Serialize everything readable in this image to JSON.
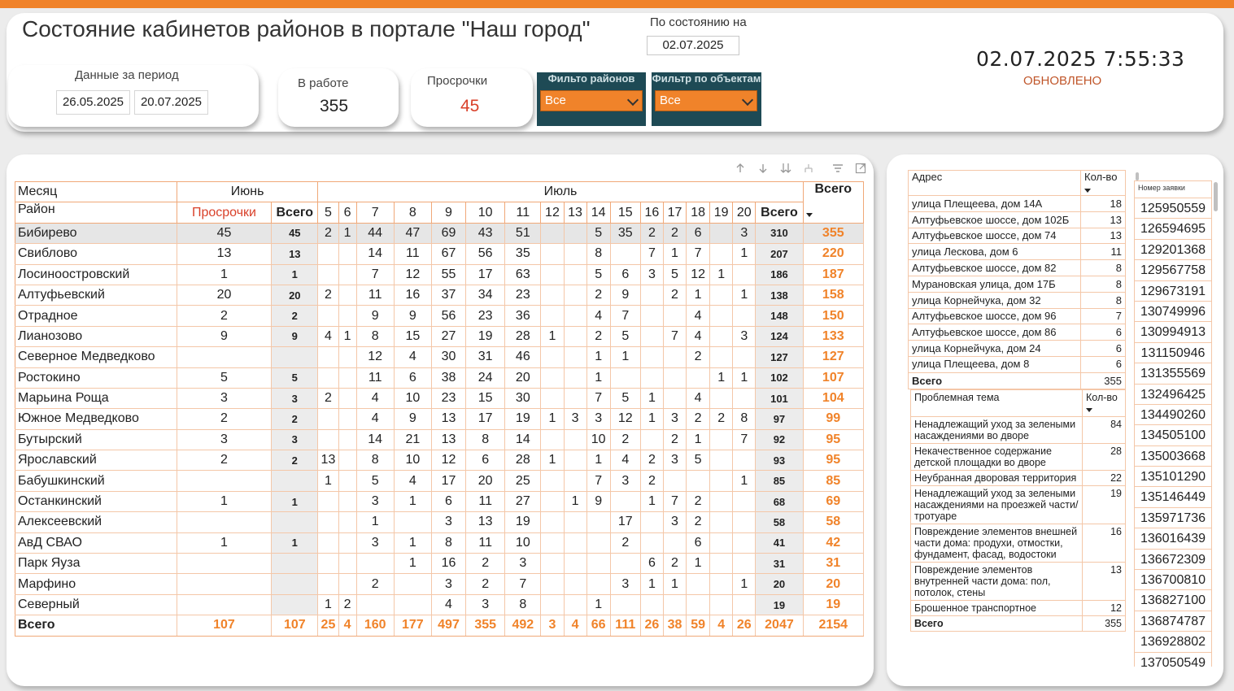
{
  "header": {
    "title": "Состояние кабинетов районов  в  портале \"Наш город\"",
    "asof_label": "По состоянию на",
    "asof_value": "02.07.2025",
    "clock": "02.07.2025 7:55:33",
    "updated": "ОБНОВЛЕНО"
  },
  "kpi": {
    "period_label": "Данные за период",
    "period_from": "26.05.2025",
    "period_to": "20.07.2025",
    "work_label": "В работе",
    "work_value": "355",
    "overdue_label": "Просрочки",
    "overdue_value": "45"
  },
  "filters": {
    "district_title": "Фильто районов",
    "district_value": "Все",
    "object_title": "Фильтр по объектам",
    "object_value": "Все"
  },
  "colors": {
    "accent": "#f0832a",
    "overdue": "#d9412a",
    "filter_bg": "#1e4a55"
  },
  "matrix": {
    "month_header": "Месяц",
    "district_header": "Район",
    "june": "Июнь",
    "july": "Июль",
    "total_header": "Всего",
    "overdue_header": "Просрочки",
    "vsego_header": "Всего",
    "days": [
      "5",
      "6",
      "7",
      "8",
      "9",
      "10",
      "11",
      "12",
      "13",
      "14",
      "15",
      "16",
      "17",
      "18",
      "19",
      "20"
    ],
    "rows": [
      {
        "name": "Бибирево",
        "overdue": "45",
        "june_total": "45",
        "days": [
          "2",
          "1",
          "44",
          "47",
          "69",
          "43",
          "51",
          "",
          "",
          "5",
          "35",
          "2",
          "2",
          "6",
          "",
          "3"
        ],
        "july_total": "310",
        "total": "355"
      },
      {
        "name": "Свиблово",
        "overdue": "13",
        "june_total": "13",
        "days": [
          "",
          "",
          "14",
          "11",
          "67",
          "56",
          "35",
          "",
          "",
          "8",
          "",
          "7",
          "1",
          "7",
          "",
          "1"
        ],
        "july_total": "207",
        "total": "220"
      },
      {
        "name": "Лосиноостровский",
        "overdue": "1",
        "june_total": "1",
        "days": [
          "",
          "",
          "7",
          "12",
          "55",
          "17",
          "63",
          "",
          "",
          "5",
          "6",
          "3",
          "5",
          "12",
          "1",
          ""
        ],
        "july_total": "186",
        "total": "187"
      },
      {
        "name": "Алтуфьевский",
        "overdue": "20",
        "june_total": "20",
        "days": [
          "2",
          "",
          "11",
          "16",
          "37",
          "34",
          "23",
          "",
          "",
          "2",
          "9",
          "",
          "2",
          "1",
          "",
          "1"
        ],
        "july_total": "138",
        "total": "158"
      },
      {
        "name": "Отрадное",
        "overdue": "2",
        "june_total": "2",
        "days": [
          "",
          "",
          "9",
          "9",
          "56",
          "23",
          "36",
          "",
          "",
          "4",
          "7",
          "",
          "",
          "4",
          "",
          ""
        ],
        "july_total": "148",
        "total": "150"
      },
      {
        "name": "Лианозово",
        "overdue": "9",
        "june_total": "9",
        "days": [
          "4",
          "1",
          "8",
          "15",
          "27",
          "19",
          "28",
          "1",
          "",
          "2",
          "5",
          "",
          "7",
          "4",
          "",
          "3"
        ],
        "july_total": "124",
        "total": "133"
      },
      {
        "name": "Северное Медведково",
        "overdue": "",
        "june_total": "",
        "days": [
          "",
          "",
          "12",
          "4",
          "30",
          "31",
          "46",
          "",
          "",
          "1",
          "1",
          "",
          "",
          "2",
          "",
          ""
        ],
        "july_total": "127",
        "total": "127"
      },
      {
        "name": "Ростокино",
        "overdue": "5",
        "june_total": "5",
        "days": [
          "",
          "",
          "11",
          "6",
          "38",
          "24",
          "20",
          "",
          "",
          "1",
          "",
          "",
          "",
          "",
          "1",
          "1"
        ],
        "july_total": "102",
        "total": "107"
      },
      {
        "name": "Марьина Роща",
        "overdue": "3",
        "june_total": "3",
        "days": [
          "2",
          "",
          "4",
          "10",
          "23",
          "15",
          "30",
          "",
          "",
          "7",
          "5",
          "1",
          "",
          "4",
          "",
          ""
        ],
        "july_total": "101",
        "total": "104"
      },
      {
        "name": "Южное Медведково",
        "overdue": "2",
        "june_total": "2",
        "days": [
          "",
          "",
          "4",
          "9",
          "13",
          "17",
          "19",
          "1",
          "3",
          "3",
          "12",
          "1",
          "3",
          "2",
          "2",
          "8"
        ],
        "july_total": "97",
        "total": "99"
      },
      {
        "name": "Бутырский",
        "overdue": "3",
        "june_total": "3",
        "days": [
          "",
          "",
          "14",
          "21",
          "13",
          "8",
          "14",
          "",
          "",
          "10",
          "2",
          "",
          "2",
          "1",
          "",
          "7"
        ],
        "july_total": "92",
        "total": "95"
      },
      {
        "name": "Ярославский",
        "overdue": "2",
        "june_total": "2",
        "days": [
          "13",
          "",
          "8",
          "10",
          "12",
          "6",
          "28",
          "1",
          "",
          "1",
          "4",
          "2",
          "3",
          "5",
          "",
          ""
        ],
        "july_total": "93",
        "total": "95"
      },
      {
        "name": "Бабушкинский",
        "overdue": "",
        "june_total": "",
        "days": [
          "1",
          "",
          "5",
          "4",
          "17",
          "20",
          "25",
          "",
          "",
          "7",
          "3",
          "2",
          "",
          "",
          "",
          "1"
        ],
        "july_total": "85",
        "total": "85"
      },
      {
        "name": "Останкинский",
        "overdue": "1",
        "june_total": "1",
        "days": [
          "",
          "",
          "3",
          "1",
          "6",
          "11",
          "27",
          "",
          "1",
          "9",
          "",
          "1",
          "7",
          "2",
          "",
          ""
        ],
        "july_total": "68",
        "total": "69"
      },
      {
        "name": "Алексеевский",
        "overdue": "",
        "june_total": "",
        "days": [
          "",
          "",
          "1",
          "",
          "3",
          "13",
          "19",
          "",
          "",
          "",
          "17",
          "",
          "3",
          "2",
          "",
          ""
        ],
        "july_total": "58",
        "total": "58"
      },
      {
        "name": "АвД СВАО",
        "overdue": "1",
        "june_total": "1",
        "days": [
          "",
          "",
          "3",
          "1",
          "8",
          "11",
          "10",
          "",
          "",
          "",
          "2",
          "",
          "",
          "6",
          "",
          ""
        ],
        "july_total": "41",
        "total": "42"
      },
      {
        "name": "Парк Яуза",
        "overdue": "",
        "june_total": "",
        "days": [
          "",
          "",
          "",
          "1",
          "16",
          "2",
          "3",
          "",
          "",
          "",
          "",
          "6",
          "2",
          "1",
          "",
          ""
        ],
        "july_total": "31",
        "total": "31"
      },
      {
        "name": "Марфино",
        "overdue": "",
        "june_total": "",
        "days": [
          "",
          "",
          "2",
          "",
          "3",
          "2",
          "7",
          "",
          "",
          "",
          "3",
          "1",
          "1",
          "",
          "",
          "1"
        ],
        "july_total": "20",
        "total": "20"
      },
      {
        "name": "Северный",
        "overdue": "",
        "june_total": "",
        "days": [
          "1",
          "2",
          "",
          "",
          "4",
          "3",
          "8",
          "",
          "",
          "1",
          "",
          "",
          "",
          "",
          "",
          ""
        ],
        "july_total": "19",
        "total": "19"
      }
    ],
    "footer": {
      "name": "Всего",
      "overdue": "107",
      "june_total": "107",
      "days": [
        "25",
        "4",
        "160",
        "177",
        "497",
        "355",
        "492",
        "3",
        "4",
        "66",
        "111",
        "26",
        "38",
        "59",
        "4",
        "26"
      ],
      "july_total": "2047",
      "total": "2154"
    }
  },
  "address_table": {
    "col_address": "Адрес",
    "col_count": "Кол-во",
    "rows": [
      {
        "address": "улица Плещеева, дом 14А",
        "count": "18"
      },
      {
        "address": "Алтуфьевское шоссе, дом 102Б",
        "count": "13"
      },
      {
        "address": "Алтуфьевское шоссе, дом 74",
        "count": "13"
      },
      {
        "address": "улица Лескова, дом 6",
        "count": "11"
      },
      {
        "address": "Алтуфьевское шоссе, дом 82",
        "count": "8"
      },
      {
        "address": "Мурановская улица, дом 17Б",
        "count": "8"
      },
      {
        "address": "улица Корнейчука, дом 32",
        "count": "8"
      },
      {
        "address": "Алтуфьевское шоссе, дом 96",
        "count": "7"
      },
      {
        "address": "Алтуфьевское шоссе, дом 86",
        "count": "6"
      },
      {
        "address": "улица Корнейчука, дом 24",
        "count": "6"
      },
      {
        "address": "улица Плещеева, дом 8",
        "count": "6"
      }
    ],
    "total_label": "Всего",
    "total_value": "355"
  },
  "topic_table": {
    "col_topic": "Проблемная тема",
    "col_count": "Кол-во",
    "rows": [
      {
        "topic": "Ненадлежащий уход за зелеными насаждениями во дворе",
        "count": "84"
      },
      {
        "topic": "Некачественное содержание детской площадки во дворе",
        "count": "28"
      },
      {
        "topic": "Неубранная дворовая территория",
        "count": "22"
      },
      {
        "topic": "Ненадлежащий уход за зелеными насаждениями на проезжей части/тротуаре",
        "count": "19"
      },
      {
        "topic": "Повреждение элементов внешней части дома: продухи, отмостки, фундамент, фасад, водостоки",
        "count": "16"
      },
      {
        "topic": "Повреждение элементов внутренней части дома: пол, потолок, стены",
        "count": "13"
      },
      {
        "topic": "Брошенное транспортное",
        "count": "12"
      }
    ],
    "total_label": "Всего",
    "total_value": "355"
  },
  "requests": {
    "header": "Номер заявки",
    "items": [
      "125950559",
      "126594695",
      "129201368",
      "129567758",
      "129673191",
      "130749996",
      "130994913",
      "131150946",
      "131355569",
      "132496425",
      "134490260",
      "134505100",
      "135003668",
      "135101290",
      "135146449",
      "135971736",
      "136016439",
      "136672309",
      "136700810",
      "136827100",
      "136874787",
      "136928802",
      "137050549"
    ]
  },
  "toolbar_icons": [
    "arrow-up-icon",
    "arrow-down-icon",
    "expand-all-icon",
    "drill-icon",
    "filter-icon",
    "focus-mode-icon"
  ]
}
